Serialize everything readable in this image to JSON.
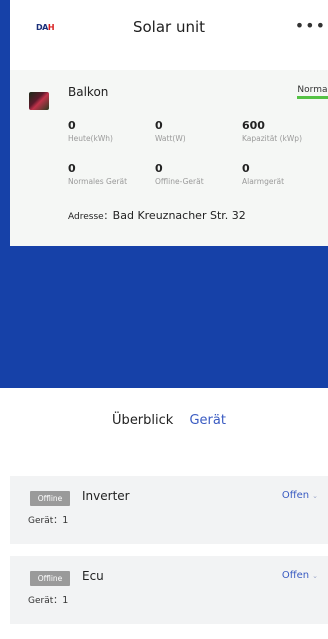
{
  "header": {
    "logo_text": "DAH",
    "title": "Solar unit",
    "more_label": "•••"
  },
  "station": {
    "name": "Balkon",
    "status": "Normal",
    "metrics": [
      {
        "value": "0",
        "label": "Heute(kWh)"
      },
      {
        "value": "0",
        "label": "Watt(W)"
      },
      {
        "value": "600",
        "label": "Kapazität (kWp)"
      },
      {
        "value": "0",
        "label": "Normales Gerät"
      },
      {
        "value": "0",
        "label": "Offline-Gerät"
      },
      {
        "value": "0",
        "label": "Alarmgerät"
      }
    ],
    "address_label": "Adresse：",
    "address_value": "Bad Kreuznacher Str. 32"
  },
  "tabs": {
    "overview": "Überblick",
    "device": "Gerät"
  },
  "devices": [
    {
      "badge": "Offline",
      "name": "Inverter",
      "action": "Offen",
      "count_label": "Gerät：",
      "count": "1"
    },
    {
      "badge": "Offline",
      "name": "Ecu",
      "action": "Offen",
      "count_label": "Gerät：",
      "count": "1"
    }
  ],
  "colors": {
    "background_blue": "#1641a8",
    "status_green": "#55c245",
    "link_blue": "#3a5bc2",
    "badge_grey": "#9a9a9a"
  },
  "icons": {
    "more": "more-dots-icon",
    "chevron": "chevron-down-icon"
  }
}
